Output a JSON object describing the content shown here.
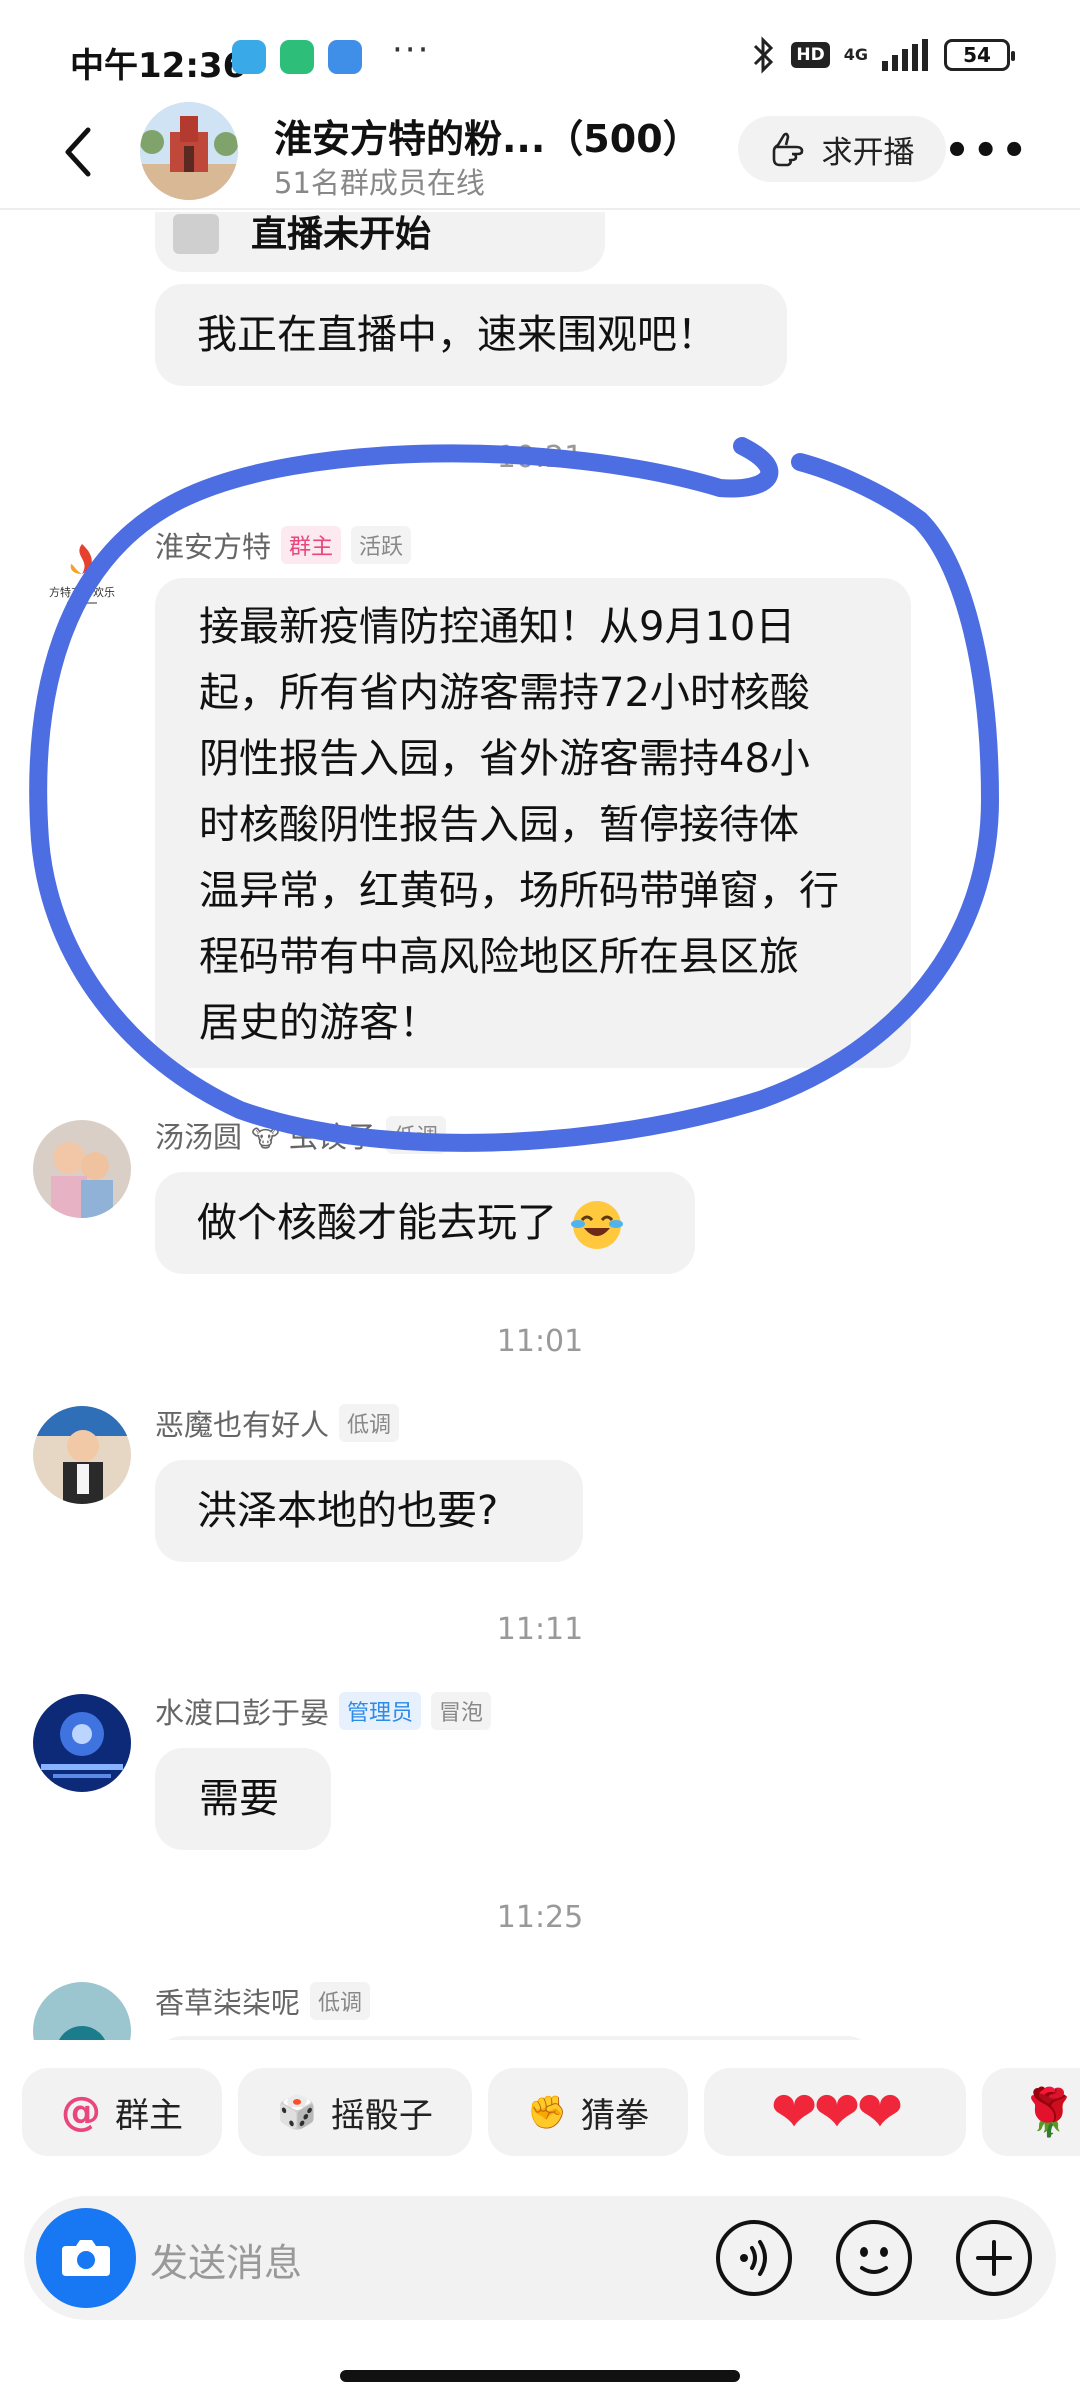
{
  "status_bar": {
    "time": "中午12:36",
    "hd_label": "HD",
    "network": "4G",
    "battery": "54",
    "more_dots": "···"
  },
  "header": {
    "title": "淮安方特的粉...（500）",
    "online": "51名群成员在线",
    "request_live": "求开播",
    "more": "•••"
  },
  "messages": {
    "partial_card_text": "直播未开始",
    "live_text": "我正在直播中，速来围观吧！",
    "partial_time": "10:21",
    "owner": {
      "name": "淮安方特",
      "tag_role": "群主",
      "tag_level": "活跃",
      "avatar_text": "方特东方欢乐",
      "lines": [
        "接最新疫情防控通知！从9月10日",
        "起，所有省内游客需持72小时核酸",
        "阴性报告入园，省外游客需持48小",
        "时核酸阴性报告入园，暂停接待体",
        "温异常，红黄码，场所码带弹窗，行",
        "程码带有中高风险地区所在县区旅",
        "居史的游客！"
      ]
    },
    "m2": {
      "name": "汤汤圆",
      "name_suffix": "虫饺子",
      "tag_level": "低调",
      "text": "做个核酸才能去玩了"
    },
    "t1": "11:01",
    "m3": {
      "name": "恶魔也有好人",
      "tag_level": "低调",
      "text": "洪泽本地的也要?"
    },
    "t2": "11:11",
    "m4": {
      "name": "水渡口彭于晏",
      "tag_role": "管理员",
      "tag_level": "冒泡",
      "text": "需要"
    },
    "t3": "11:25",
    "m5": {
      "name": "香草柒柒呢",
      "tag_level": "低调"
    }
  },
  "quick_replies": {
    "owner": {
      "icon": "@",
      "label": "群主"
    },
    "dice": {
      "icon": "🎲",
      "label": "摇骰子"
    },
    "rps": {
      "icon": "✊",
      "label": "猜拳"
    },
    "hearts": "❤❤❤",
    "rose": "🌹"
  },
  "input": {
    "placeholder": "发送消息"
  },
  "colors": {
    "annotation_blue": "#4d6de3",
    "accent_blue": "#1877f2",
    "owner_pink": "#e8467c",
    "admin_blue": "#2c8ae8"
  }
}
